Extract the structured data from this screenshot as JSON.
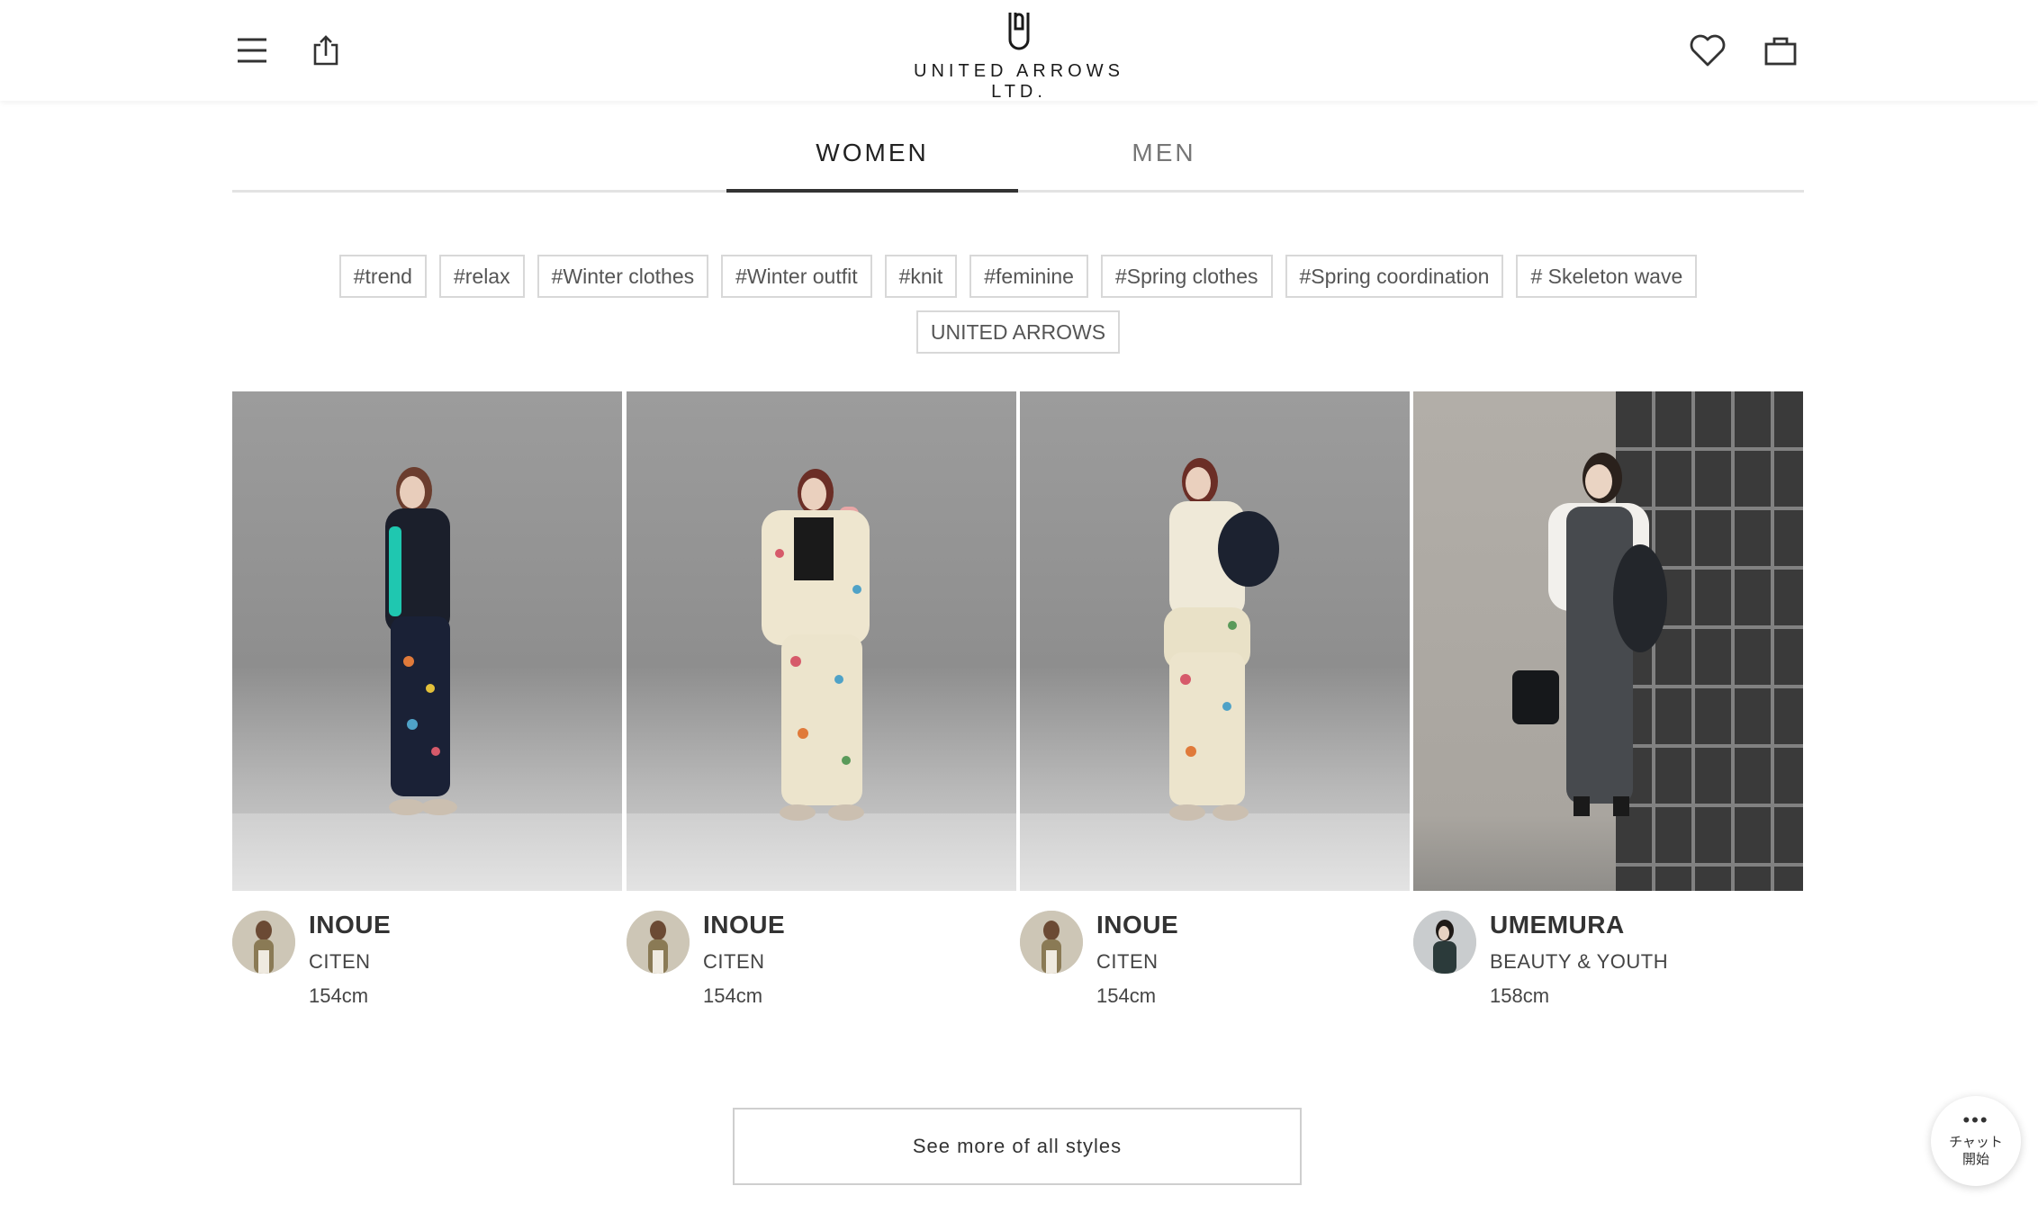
{
  "header": {
    "brand": "UNITED ARROWS LTD.",
    "icons": [
      "menu-icon",
      "share-icon",
      "heart-icon",
      "bag-icon"
    ]
  },
  "tabs": [
    {
      "label": "WOMEN",
      "active": true
    },
    {
      "label": "MEN",
      "active": false
    }
  ],
  "hashtags": [
    "#trend",
    "#relax",
    "#Winter clothes",
    "#Winter outfit",
    "#knit",
    "#feminine",
    "#Spring clothes",
    "#Spring coordination",
    "# Skeleton wave",
    "UNITED ARROWS"
  ],
  "styles": [
    {
      "name": "INOUE",
      "brand": "CITEN",
      "height": "154cm"
    },
    {
      "name": "INOUE",
      "brand": "CITEN",
      "height": "154cm"
    },
    {
      "name": "INOUE",
      "brand": "CITEN",
      "height": "154cm"
    },
    {
      "name": "UMEMURA",
      "brand": "BEAUTY & YOUTH",
      "height": "158cm"
    }
  ],
  "see_more_label": "See more of all styles",
  "chat": {
    "label": "チャット\n開始"
  },
  "colors": {
    "text": "#333333",
    "border": "#d8d8d8",
    "active_tab": "#333333"
  }
}
